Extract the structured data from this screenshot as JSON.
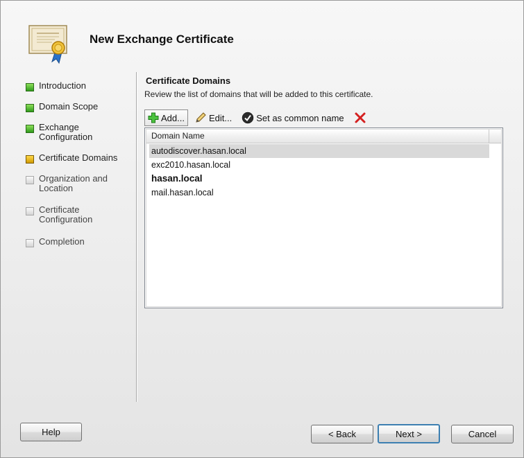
{
  "window": {
    "title": "New Exchange Certificate",
    "icon": "certificate-icon"
  },
  "nav": {
    "items": [
      {
        "label": "Introduction",
        "state": "done"
      },
      {
        "label": "Domain Scope",
        "state": "done"
      },
      {
        "label": "Exchange Configuration",
        "state": "done"
      },
      {
        "label": "Certificate Domains",
        "state": "current"
      },
      {
        "label": "Organization and Location",
        "state": "pending"
      },
      {
        "label": "Certificate Configuration",
        "state": "pending"
      },
      {
        "label": "Completion",
        "state": "pending"
      }
    ]
  },
  "main": {
    "title": "Certificate Domains",
    "description": "Review the list of domains that will be added to this certificate.",
    "toolbar": {
      "add_label": "Add...",
      "edit_label": "Edit...",
      "set_common_label": "Set as common name"
    },
    "list": {
      "column_header": "Domain Name",
      "rows": [
        "autodiscover.hasan.local",
        "exc2010.hasan.local",
        "hasan.local",
        "mail.hasan.local"
      ]
    }
  },
  "footer": {
    "help_label": "Help",
    "back_label": "< Back",
    "next_label": "Next >",
    "cancel_label": "Cancel"
  },
  "colors": {
    "done": "#2f9a1b",
    "current": "#d19a00",
    "pending": "#d4d4d4",
    "delete_icon": "#d42020",
    "add_icon": "#2fa52a"
  }
}
